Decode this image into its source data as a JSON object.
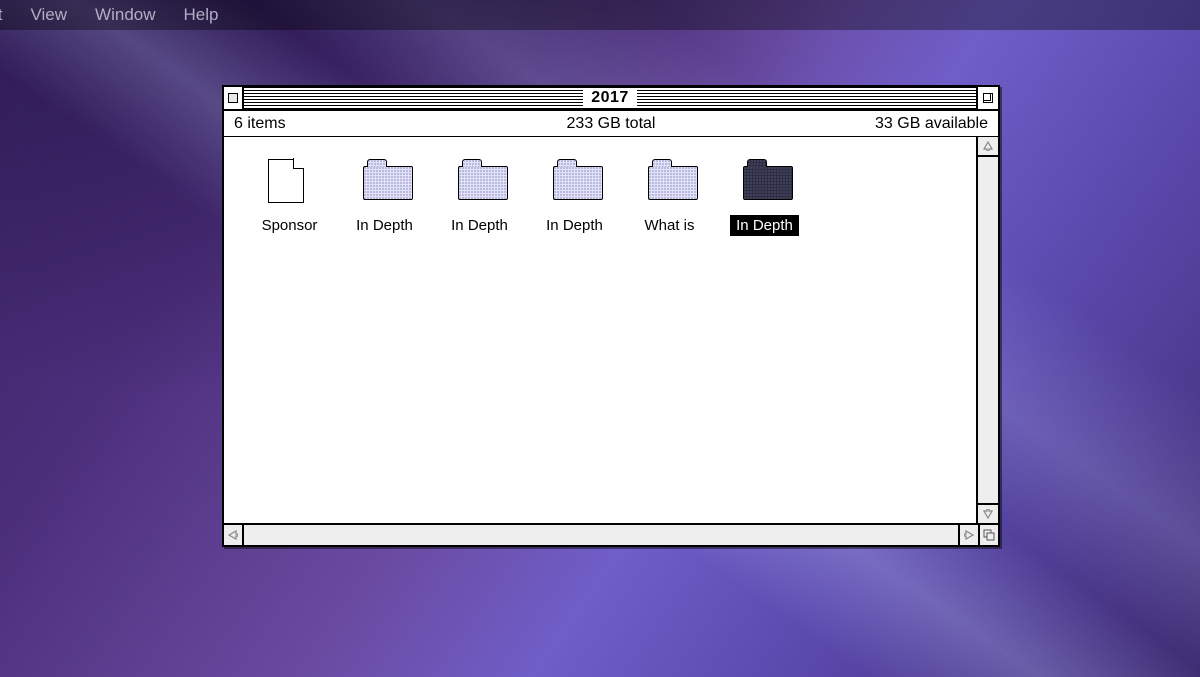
{
  "menubar": {
    "items": [
      "it",
      "View",
      "Window",
      "Help"
    ]
  },
  "window": {
    "title": "2017",
    "status": {
      "item_count": "6 items",
      "total": "233 GB total",
      "available": "33 GB available"
    },
    "items": [
      {
        "label": "Sponsor",
        "type": "doc",
        "selected": false
      },
      {
        "label": "In Depth",
        "type": "folder",
        "selected": false
      },
      {
        "label": "In Depth",
        "type": "folder",
        "selected": false
      },
      {
        "label": "In Depth",
        "type": "folder",
        "selected": false
      },
      {
        "label": "What is",
        "type": "folder",
        "selected": false
      },
      {
        "label": "In Depth",
        "type": "folder",
        "selected": true
      }
    ]
  }
}
